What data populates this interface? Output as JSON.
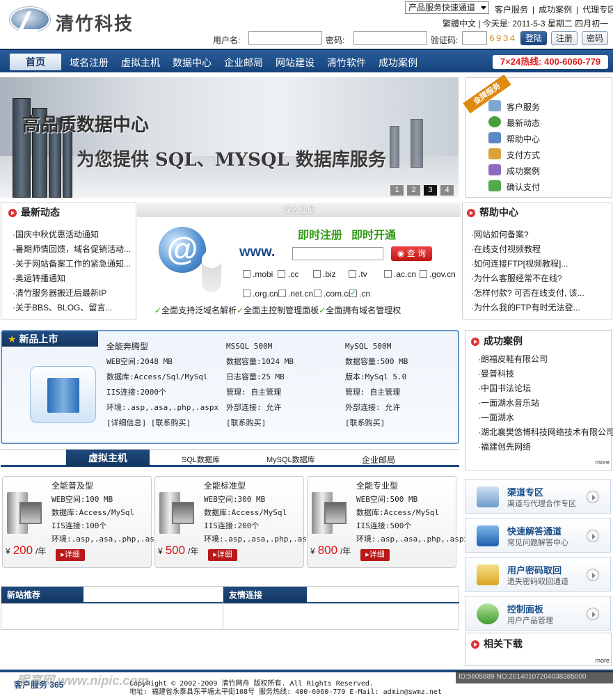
{
  "header": {
    "brand": "清竹科技",
    "service_select": "产品服务快速通道",
    "top_links": [
      "客户服务",
      "|",
      "成功案例",
      "|",
      "代理专区"
    ],
    "date_line": "繁體中文 | 今天是: 2011-5-3 星期二 四月初一",
    "login": {
      "username_label": "用户名:",
      "password_label": "密码:",
      "captcha_label": "验证码:",
      "captcha_value": "6934",
      "login_button": "登陆",
      "register_button": "注册",
      "password_button": "密码"
    }
  },
  "nav": {
    "items": [
      "首页",
      "域名注册",
      "虚拟主机",
      "数据中心",
      "企业邮局",
      "网站建设",
      "清竹软件",
      "成功案例"
    ],
    "hotline": "7×24热线: 400-6060-779"
  },
  "banner": {
    "title": "高品质数据中心",
    "subtitle": "为您提供 SQL、MYSQL 数据库服务",
    "pages": [
      "1",
      "2",
      "3",
      "4"
    ],
    "active_page": "3"
  },
  "service_panel": {
    "ribbon": "金牌服务",
    "items": [
      "客户服务",
      "最新动态",
      "帮助中心",
      "支付方式",
      "成功案例",
      "确认支付"
    ]
  },
  "news": {
    "title": "最新动态",
    "items": [
      "国庆中秋优惠活动通知",
      "暑期师情回馈，域名促销活动...",
      "关于网站备案工作的紧急通知...",
      "奥运转播通知",
      "清竹服务器搬迁后最新IP",
      "关于BBS、BLOG、留言..."
    ]
  },
  "domain": {
    "header": "域名注册",
    "slogan1": "即时注册",
    "slogan2": "即时开通",
    "www": "www.",
    "search_button": "查 询",
    "tlds": [
      ".mobi",
      ".cc",
      ".biz",
      ".tv",
      ".ac.cn",
      ".gov.cn",
      ".org.cn",
      ".net.cn",
      ".com.cn",
      ".cn"
    ],
    "features": [
      "全面支持泛域名解析",
      "全面主控制管理面板",
      "全面拥有域名管理权"
    ]
  },
  "help": {
    "title": "帮助中心",
    "items": [
      "网站如何备案?",
      "在线支付视频教程",
      "如何连接FTP[视频教程]...",
      "为什么客服经常不在线?",
      "怎样付款? 可否在线支付, 该...",
      "为什么我的FTP有时无法登..."
    ]
  },
  "new_products": {
    "title": "新品上市",
    "columns": [
      {
        "name": "全能奔腾型",
        "lines": [
          "WEB空间:2048 MB",
          "数据库:Access/Sql/MySql",
          "IIS连接:2000个",
          "环境:.asp,.asa,.php,.aspx",
          "[详细信息] [联系购买]"
        ]
      },
      {
        "name": "MSSQL 500M",
        "lines": [
          "数据容量:1024 MB",
          "日志容量:25 MB",
          "管理: 自主管理",
          "外部连接: 允许",
          "[联系购买]"
        ]
      },
      {
        "name": "MySQL 500M",
        "lines": [
          "数据容量:500 MB",
          "版本:MySql 5.0",
          "管理: 自主管理",
          "外部连接: 允许",
          "[联系购买]"
        ]
      }
    ]
  },
  "hosting": {
    "tabs": [
      "虚拟主机",
      "SQL数据库",
      "MySQL数据库",
      "企业邮局"
    ],
    "cards": [
      {
        "name": "全能普及型",
        "lines": [
          "WEB空间:100 MB",
          "数据库:Access/MySql",
          "IIS连接:100个",
          "环境:.asp,.asa,.php,.aspx"
        ],
        "currency": "¥",
        "price": "200",
        "unit": "/年",
        "detail": "详细"
      },
      {
        "name": "全能标准型",
        "lines": [
          "WEB空间:300 MB",
          "数据库:Access/MySql",
          "IIS连接:200个",
          "环境:.asp,.asa,.php,.aspx"
        ],
        "currency": "¥",
        "price": "500",
        "unit": "/年",
        "detail": "详细"
      },
      {
        "name": "全能专业型",
        "lines": [
          "WEB空间:500 MB",
          "数据库:Access/MySql",
          "IIS连接:500个",
          "环境:.asp,.asa,.php,.aspx"
        ],
        "currency": "¥",
        "price": "800",
        "unit": "/年",
        "detail": "详细"
      }
    ]
  },
  "cases": {
    "title": "成功案例",
    "items": [
      "朗福皮鞋有限公司",
      "曼普科技",
      "中国书法论坛",
      "一面湖水音乐站",
      "一面湖水",
      "湖北襄樊悠博科技网络技术有限公司",
      "福建创先网络"
    ],
    "more": "more"
  },
  "side_cards": [
    {
      "title": "渠道专区",
      "sub": "渠道与代理合作专区"
    },
    {
      "title": "快速解答通道",
      "sub": "常见问题解答中心"
    },
    {
      "title": "用户密码取回",
      "sub": "遗失密码取回通道"
    },
    {
      "title": "控制面板",
      "sub": "用户产品管理"
    }
  ],
  "downloads": {
    "title": "相关下载",
    "more": "more"
  },
  "bottom_tabs": {
    "left": "新站推荐",
    "right": "友情连接"
  },
  "footer": {
    "copyright": "CopyRight © 2002-2009 清竹网舟 版权所有. All Rights Reserved.",
    "address": "地址: 福建省永泰县东平塘太平街108号  服务热线: 400-6060-779  E-Mail: admin@swmz.net",
    "watermark": "昵享网 www.nipic.com",
    "id_stamp": "ID:5605889 NO:20140107204038385000",
    "badge": "客户服务 365"
  }
}
